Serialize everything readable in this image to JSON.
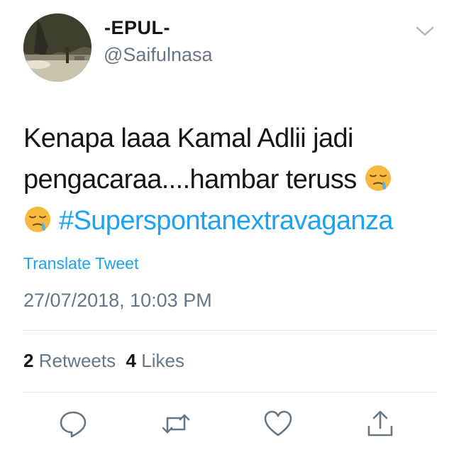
{
  "user": {
    "display_name": "-EPUL-",
    "handle": "@Saifulnasa",
    "avatar_icon": "avatar-photo-cave-beach"
  },
  "tweet": {
    "line1": "Kenapa laaa Kamal Adlii jadi",
    "line2": "pengacaraa....hambar teruss",
    "emoji_name": "sleepy-face-emoji",
    "hashtag": "#Superspontanextravaganza",
    "translate_label": "Translate Tweet",
    "timestamp": "27/07/2018, 10:03 PM"
  },
  "stats": {
    "retweets_count": "2",
    "retweets_label": "Retweets",
    "likes_count": "4",
    "likes_label": "Likes"
  },
  "actions": [
    "reply-icon",
    "retweet-icon",
    "like-icon",
    "share-icon"
  ],
  "colors": {
    "link": "#1da1f2",
    "text": "#14171a",
    "secondary": "#657786",
    "divider": "#e1e8ed"
  }
}
